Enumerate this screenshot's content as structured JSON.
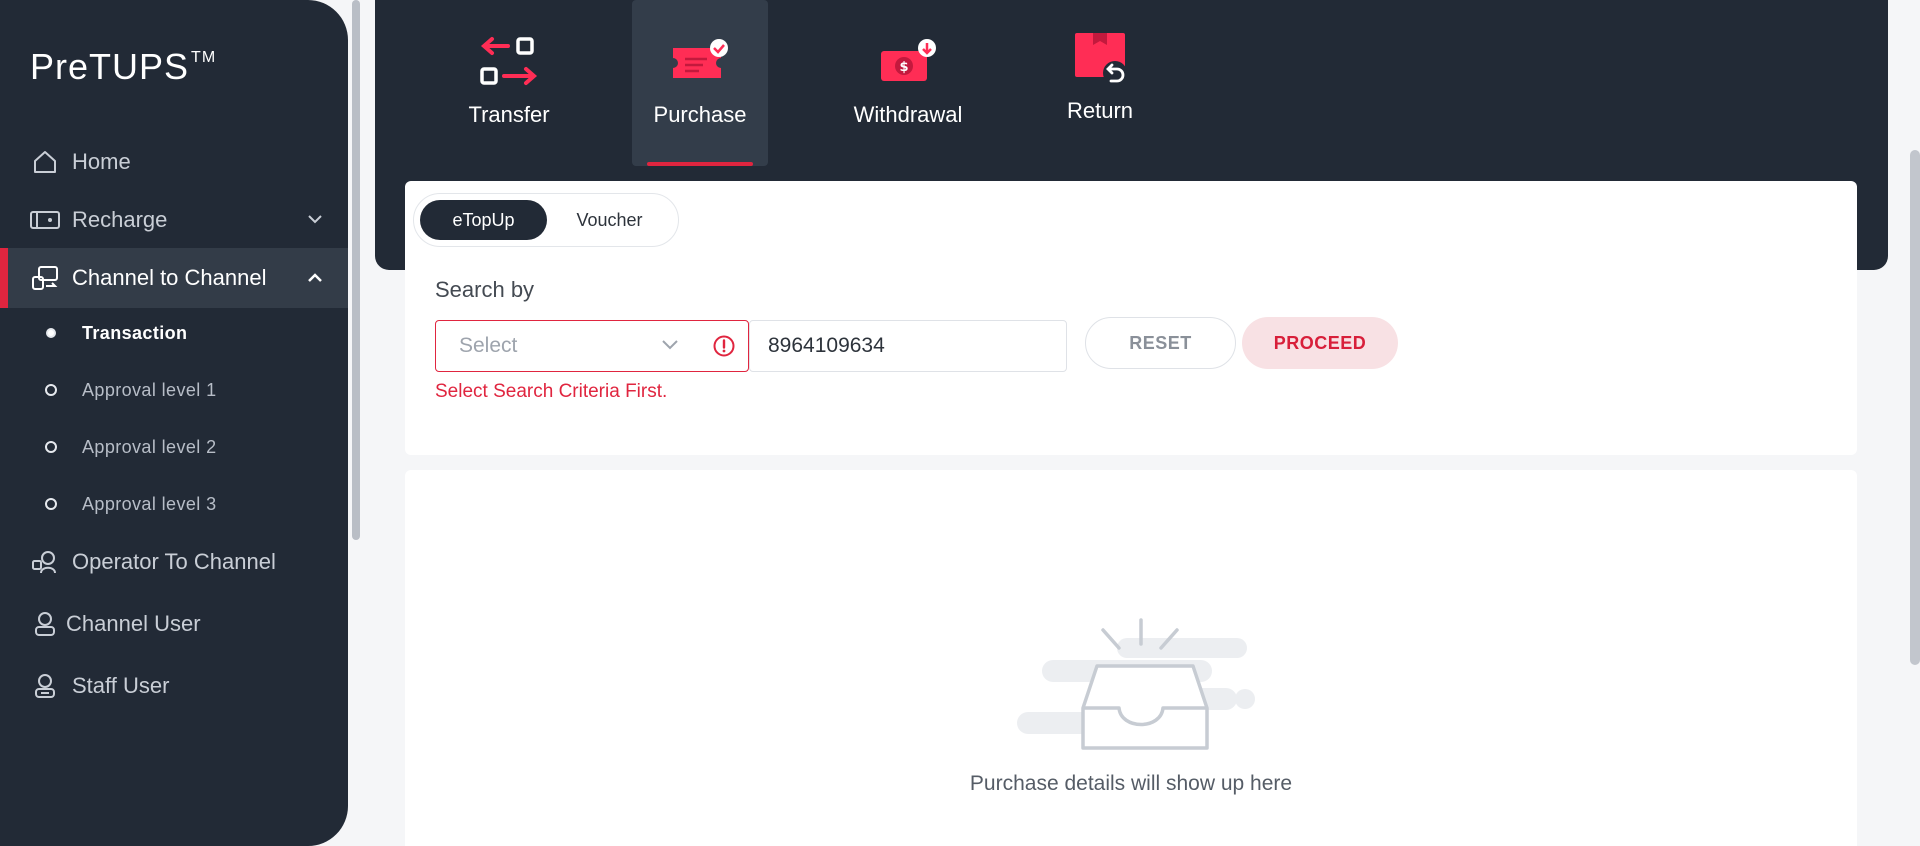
{
  "app": {
    "brand": "PreTUPS",
    "brand_mark": "TM"
  },
  "sidebar": {
    "items": [
      {
        "label": "Home",
        "icon": "home-icon"
      },
      {
        "label": "Recharge",
        "icon": "recharge-icon"
      },
      {
        "label": "Channel to Channel",
        "icon": "channel-transfer-icon"
      },
      {
        "label": "Operator To Channel",
        "icon": "operator-icon"
      },
      {
        "label": "Channel User",
        "icon": "user-icon"
      },
      {
        "label": "Staff User",
        "icon": "staff-user-icon"
      }
    ],
    "subitems": [
      {
        "label": "Transaction",
        "active": true
      },
      {
        "label": "Approval level 1",
        "active": false
      },
      {
        "label": "Approval level 2",
        "active": false
      },
      {
        "label": "Approval level 3",
        "active": false
      }
    ]
  },
  "transaction_tabs": [
    {
      "label": "Transfer",
      "icon": "transfer-icon"
    },
    {
      "label": "Purchase",
      "icon": "purchase-ticket-icon",
      "active": true
    },
    {
      "label": "Withdrawal",
      "icon": "withdrawal-icon"
    },
    {
      "label": "Return",
      "icon": "return-icon"
    }
  ],
  "product_toggle": {
    "options": [
      "eTopUp",
      "Voucher"
    ],
    "selected": "eTopUp"
  },
  "search": {
    "label": "Search by",
    "select_placeholder": "Select",
    "input_value": "8964109634",
    "error": "Select Search Criteria First.",
    "reset_label": "RESET",
    "proceed_label": "PROCEED"
  },
  "empty_state": {
    "message": "Purchase details will show up here"
  },
  "colors": {
    "accent": "#e0253f",
    "sidebar_bg": "#222a36",
    "page_bg": "#f5f6f8"
  }
}
